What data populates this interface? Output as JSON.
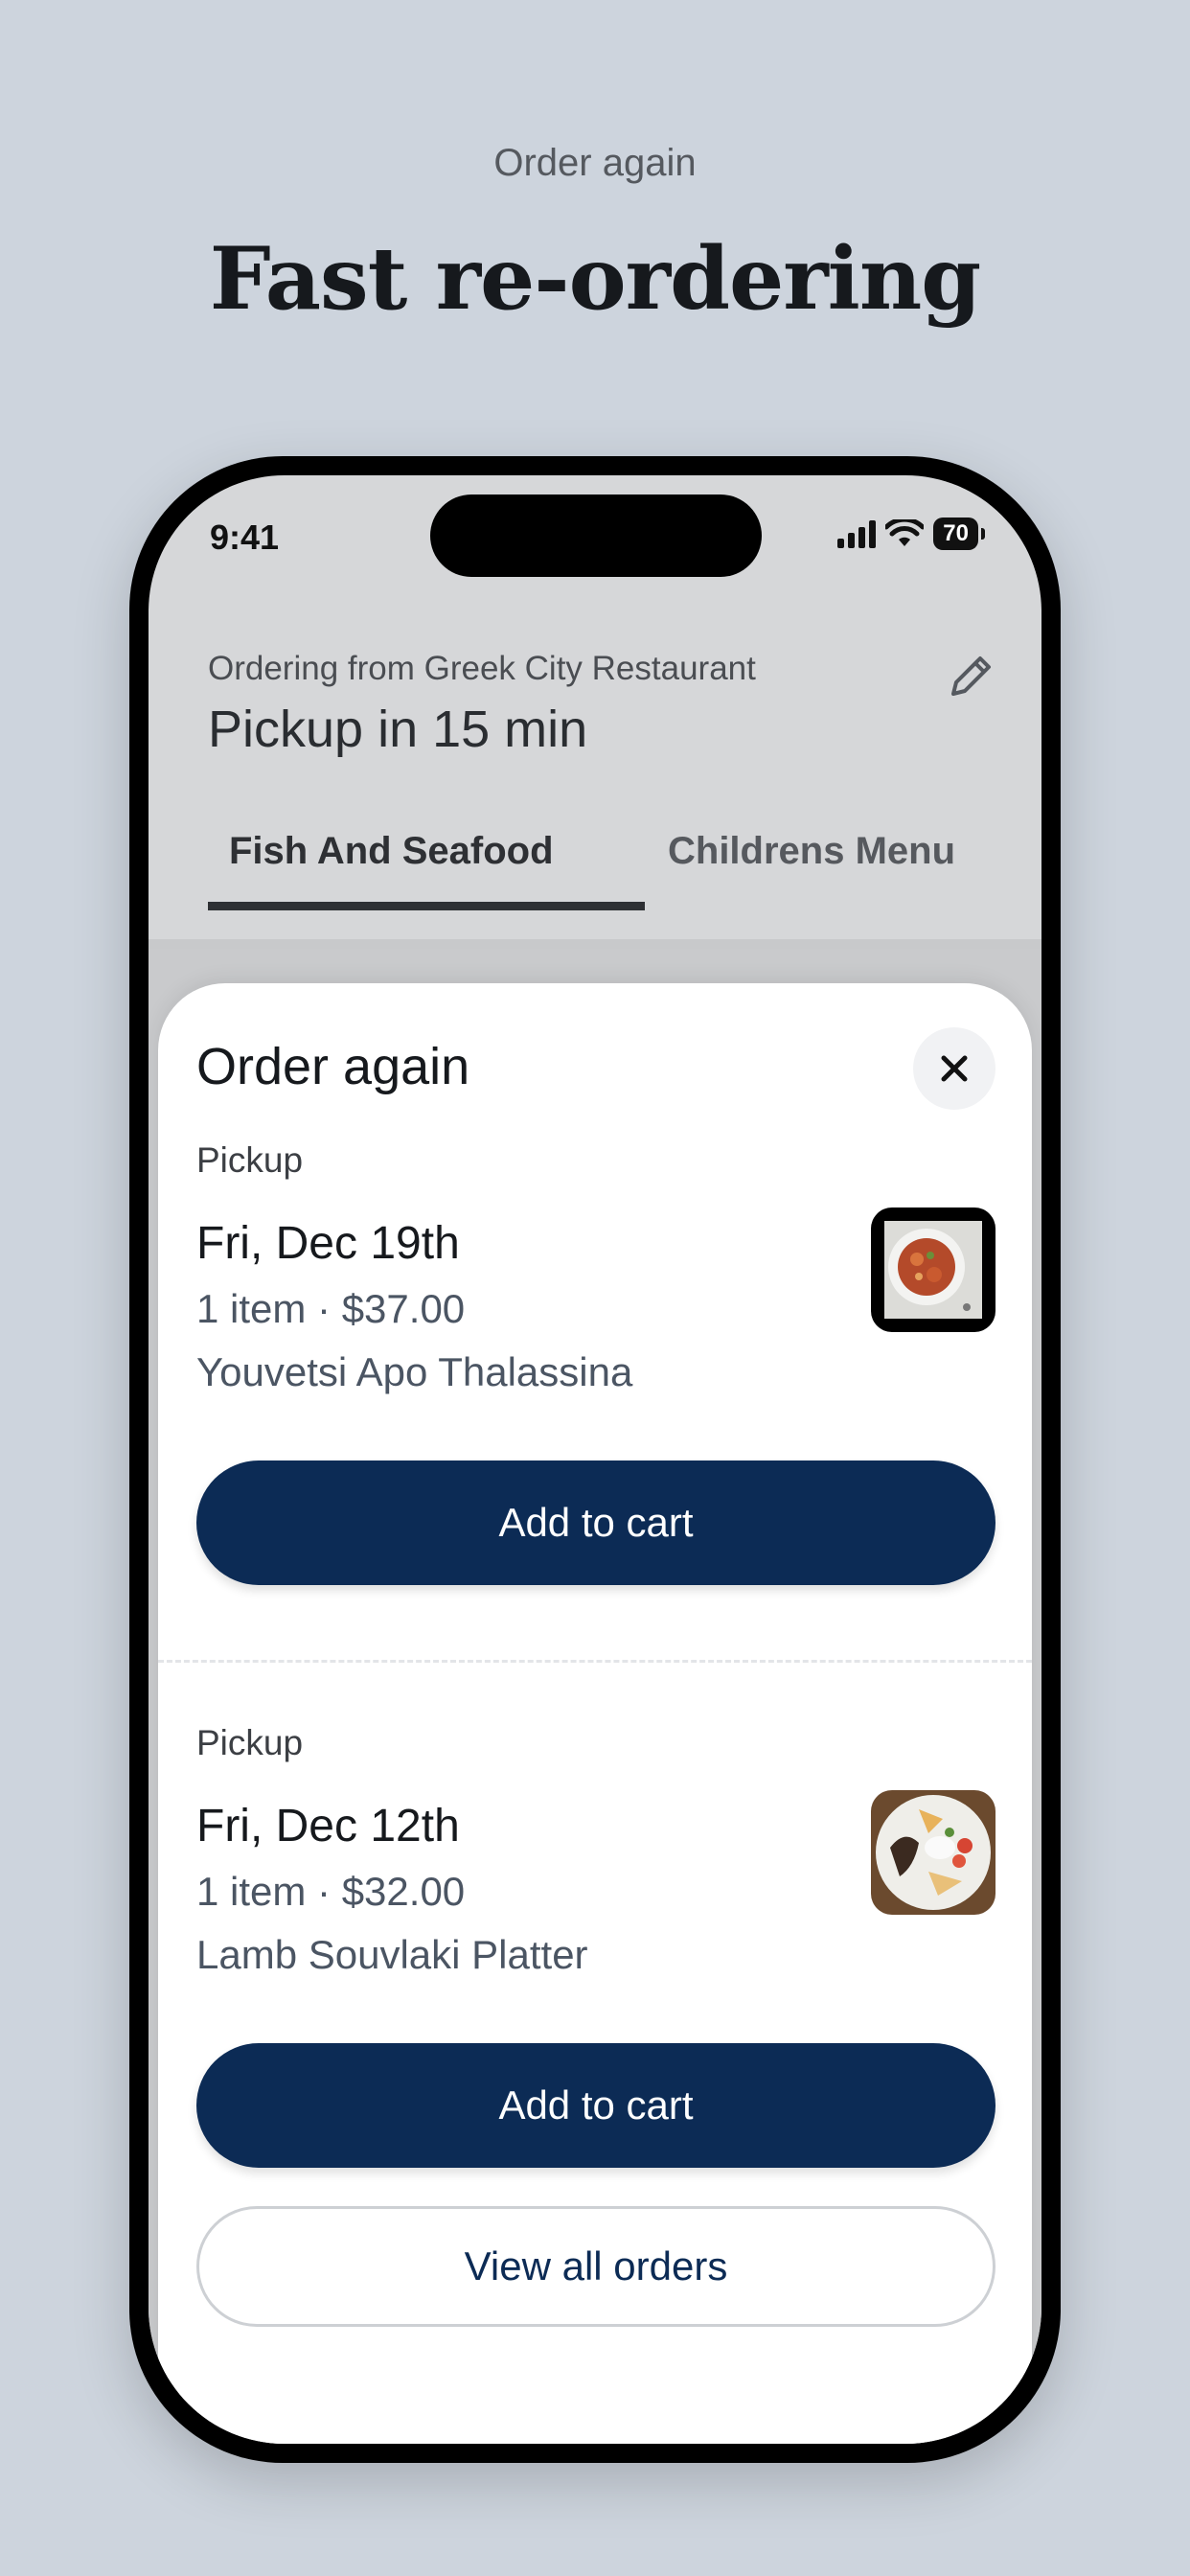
{
  "promo": {
    "caption": "Order again",
    "headline": "Fast re-ordering"
  },
  "status_bar": {
    "time": "9:41",
    "battery": "70"
  },
  "header": {
    "ordering_from": "Ordering from Greek City Restaurant",
    "pickup_eta": "Pickup in 15 min",
    "edit_icon": "pencil-icon"
  },
  "tabs": [
    {
      "label": "Fish And Seafood",
      "active": true
    },
    {
      "label": "Childrens Menu",
      "active": false
    }
  ],
  "sheet": {
    "title": "Order again",
    "close_icon": "close-icon",
    "orders": [
      {
        "kind": "Pickup",
        "date": "Fri, Dec 19th",
        "summary": "1 item · $37.00",
        "item": "Youvetsi Apo Thalassina",
        "button": "Add to cart"
      },
      {
        "kind": "Pickup",
        "date": "Fri, Dec 12th",
        "summary": "1 item · $32.00",
        "item": "Lamb Souvlaki Platter",
        "button": "Add to cart"
      }
    ],
    "view_all": "View all orders"
  },
  "colors": {
    "brand_navy": "#0c2b55",
    "page_background": "#cdd4dd"
  }
}
